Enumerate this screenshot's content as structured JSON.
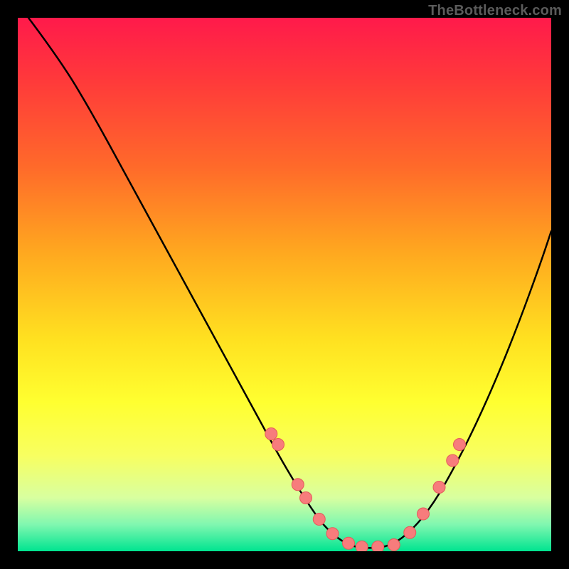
{
  "attribution": "TheBottleneck.com",
  "chart_data": {
    "type": "line",
    "title": "",
    "xlabel": "",
    "ylabel": "",
    "xlim": [
      0,
      100
    ],
    "ylim": [
      0,
      100
    ],
    "curve": {
      "x": [
        2,
        8,
        14,
        20,
        26,
        32,
        38,
        44,
        50,
        55,
        58,
        62,
        66,
        70,
        74,
        78,
        82,
        86,
        90,
        94,
        98,
        100
      ],
      "y": [
        100,
        92,
        82,
        71,
        60,
        49,
        38,
        27,
        16,
        8,
        4,
        1,
        0.5,
        1,
        4,
        9,
        16,
        24,
        33,
        43,
        54,
        60
      ]
    },
    "series": [
      {
        "name": "points",
        "x": [
          47.5,
          48.8,
          52.5,
          54.0,
          56.5,
          59.0,
          62.0,
          64.5,
          67.5,
          70.5,
          73.5,
          76.0,
          79.0,
          81.5,
          82.8
        ],
        "y": [
          22.0,
          20.0,
          12.5,
          10.0,
          6.0,
          3.3,
          1.5,
          0.8,
          0.8,
          1.2,
          3.5,
          7.0,
          12.0,
          17.0,
          20.0
        ]
      }
    ],
    "background_gradient": {
      "top": "#ff1a4b",
      "mid": "#ffe020",
      "bottom": "#00e490"
    }
  }
}
